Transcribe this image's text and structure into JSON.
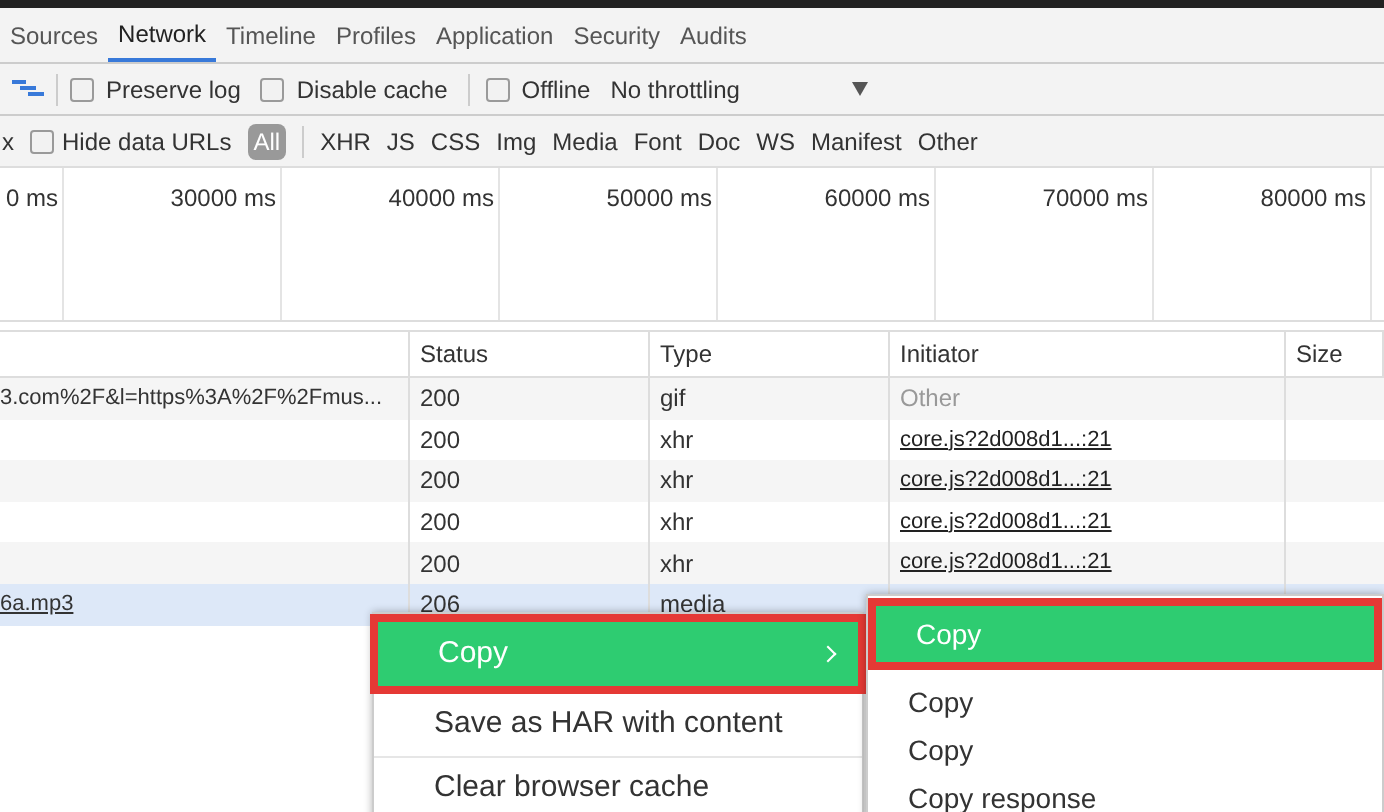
{
  "tabs": [
    {
      "label": "Sources",
      "selected": false
    },
    {
      "label": "Network",
      "selected": true
    },
    {
      "label": "Timeline",
      "selected": false
    },
    {
      "label": "Profiles",
      "selected": false
    },
    {
      "label": "Application",
      "selected": false
    },
    {
      "label": "Security",
      "selected": false
    },
    {
      "label": "Audits",
      "selected": false
    }
  ],
  "toolbar": {
    "options": [
      {
        "label": "Preserve log",
        "checked": false
      },
      {
        "label": "Disable cache",
        "checked": false
      },
      {
        "label": "Offline",
        "checked": false
      }
    ],
    "throttling": "No throttling"
  },
  "filter_bar": {
    "cut_text": "x",
    "hide_data_urls": {
      "label": "Hide data URLs",
      "checked": false
    },
    "types": [
      {
        "label": "All",
        "selected": true
      },
      {
        "label": "XHR",
        "selected": false
      },
      {
        "label": "JS",
        "selected": false
      },
      {
        "label": "CSS",
        "selected": false
      },
      {
        "label": "Img",
        "selected": false
      },
      {
        "label": "Media",
        "selected": false
      },
      {
        "label": "Font",
        "selected": false
      },
      {
        "label": "Doc",
        "selected": false
      },
      {
        "label": "WS",
        "selected": false
      },
      {
        "label": "Manifest",
        "selected": false
      },
      {
        "label": "Other",
        "selected": false
      }
    ]
  },
  "timeline_ticks": [
    "0 ms",
    "30000 ms",
    "40000 ms",
    "50000 ms",
    "60000 ms",
    "70000 ms",
    "80000 ms"
  ],
  "table": {
    "columns": [
      "Status",
      "Type",
      "Initiator",
      "Size"
    ],
    "rows": [
      {
        "name": "3.com%2F&l=https%3A%2F%2Fmus...",
        "status": "200",
        "type": "gif",
        "initiator": "Other",
        "initiator_link": false,
        "selected": false
      },
      {
        "name": "",
        "status": "200",
        "type": "xhr",
        "initiator": "core.js?2d008d1...:21",
        "initiator_link": true,
        "selected": false
      },
      {
        "name": "",
        "status": "200",
        "type": "xhr",
        "initiator": "core.js?2d008d1...:21",
        "initiator_link": true,
        "selected": false
      },
      {
        "name": "",
        "status": "200",
        "type": "xhr",
        "initiator": "core.js?2d008d1...:21",
        "initiator_link": true,
        "selected": false
      },
      {
        "name": "",
        "status": "200",
        "type": "xhr",
        "initiator": "core.js?2d008d1...:21",
        "initiator_link": true,
        "selected": false
      },
      {
        "name": "6a.mp3",
        "status": "206",
        "type": "media",
        "selected": true
      }
    ]
  },
  "context_menu": {
    "items": [
      {
        "label": "Copy",
        "submenu": true,
        "selected": true
      },
      {
        "label": "Save as HAR with content",
        "submenu": false,
        "selected": false
      },
      {
        "label": "Clear browser cache",
        "submenu": false,
        "selected": false
      }
    ]
  },
  "submenu": {
    "items": [
      {
        "label": "Copy",
        "selected": true
      },
      {
        "label": "Copy",
        "selected": false
      },
      {
        "label": "Copy",
        "selected": false
      },
      {
        "label": "Copy response",
        "selected": false
      }
    ]
  }
}
